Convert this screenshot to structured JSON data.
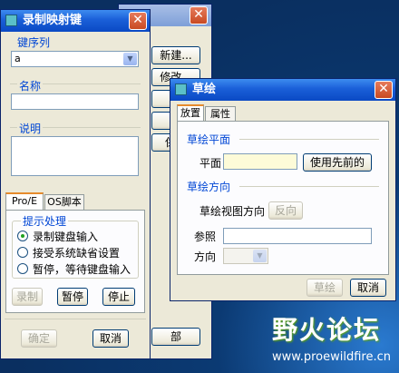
{
  "colors": {
    "title_active": "#1a5fd8",
    "dialog_bg": "#ece9d8",
    "accent_green": "#21a121"
  },
  "behind_window": {
    "buttons": [
      "新建...",
      "修改...",
      "运",
      "删",
      "保存"
    ],
    "bottom_button": "部"
  },
  "record_dialog": {
    "title": "录制映射键",
    "close_icon": "close-icon",
    "key_sequence_label": "键序列",
    "key_sequence_value": "a",
    "name_label": "名称",
    "name_value": "",
    "description_label": "说明",
    "description_value": "",
    "tabs": [
      "Pro/E",
      "OS脚本"
    ],
    "prompt_group": "提示处理",
    "radios": [
      "录制键盘输入",
      "接受系统缺省设置",
      "暂停，等待键盘输入"
    ],
    "selected_radio": 0,
    "record_button": "录制",
    "pause_button": "暂停",
    "stop_button": "停止",
    "ok_button": "确定",
    "cancel_button": "取消"
  },
  "sketch_dialog": {
    "title": "草绘",
    "tabs": [
      "放置",
      "属性"
    ],
    "sketch_plane_group": "草绘平面",
    "plane_label": "平面",
    "plane_value": "",
    "use_previous_button": "使用先前的",
    "orientation_group": "草绘方向",
    "view_direction_label": "草绘视图方向",
    "flip_button": "反向",
    "reference_label": "参照",
    "reference_value": "",
    "direction_label": "方向",
    "direction_value": "",
    "sketch_button": "草绘",
    "cancel_button": "取消"
  },
  "watermark": {
    "title": "野火论坛",
    "url": "www.proewildfire.cn"
  }
}
